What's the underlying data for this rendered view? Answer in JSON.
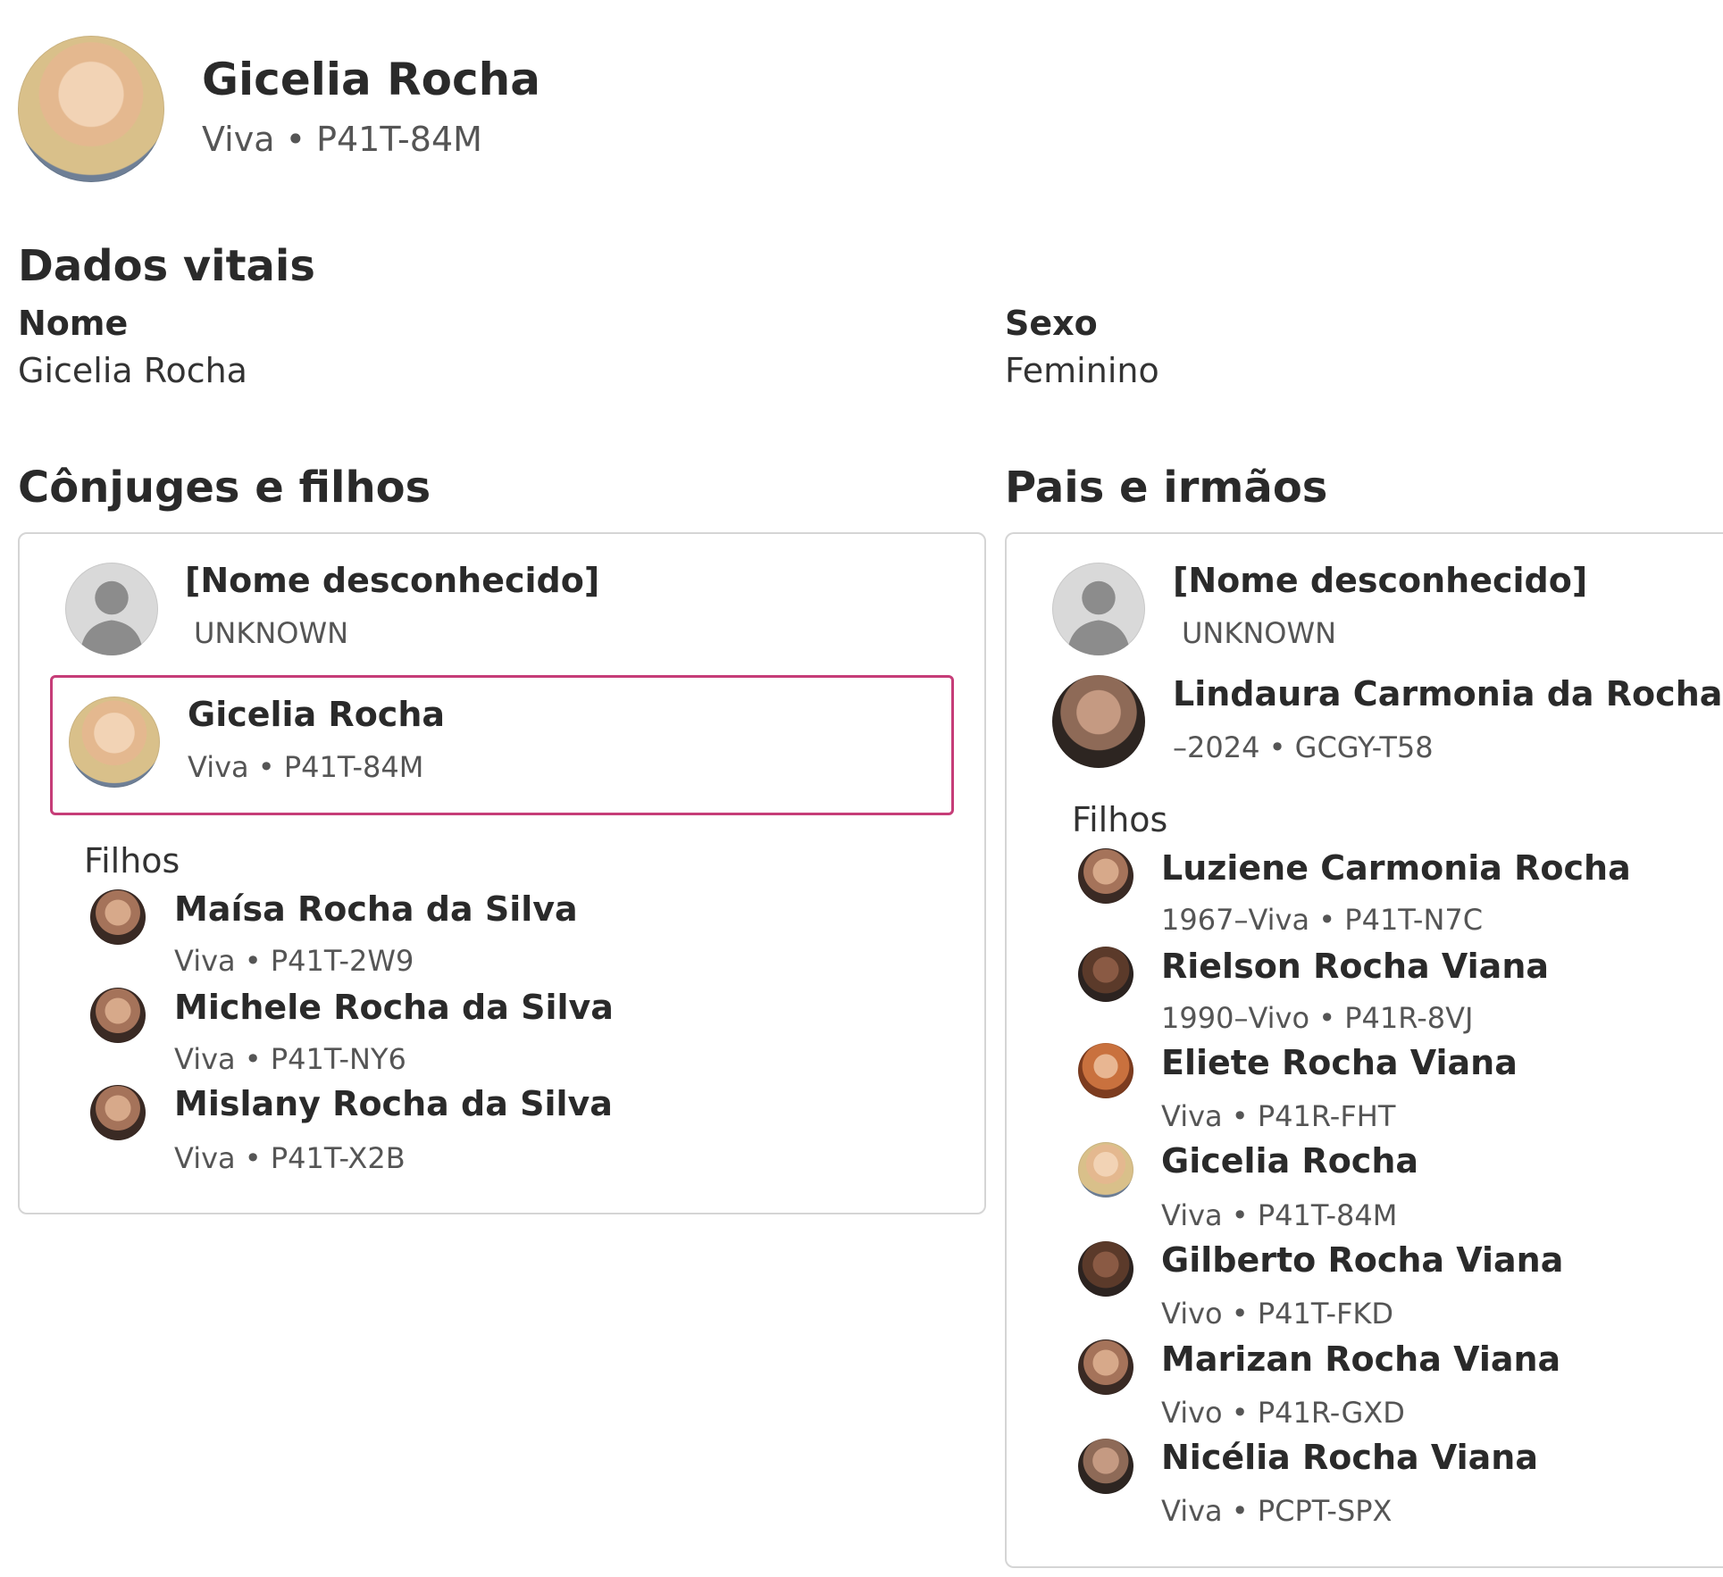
{
  "header": {
    "name": "Gicelia Rocha",
    "sub": "Viva • P41T-84M"
  },
  "vitals": {
    "heading": "Dados vitais",
    "name_label": "Nome",
    "name_value": "Gicelia Rocha",
    "sex_label": "Sexo",
    "sex_value": "Feminino"
  },
  "spouses": {
    "heading": "Cônjuges e filhos",
    "parent1": {
      "name": "[Nome desconhecido]",
      "sub": "UNKNOWN"
    },
    "parent2": {
      "name": "Gicelia Rocha",
      "sub": "Viva • P41T-84M"
    },
    "children_label": "Filhos",
    "children": [
      {
        "name": "Maísa Rocha da Silva",
        "sub": "Viva • P41T-2W9"
      },
      {
        "name": "Michele Rocha da Silva",
        "sub": "Viva • P41T-NY6"
      },
      {
        "name": "Mislany Rocha da Silva",
        "sub": "Viva • P41T-X2B"
      }
    ]
  },
  "parents": {
    "heading": "Pais e irmãos",
    "parent1": {
      "name": "[Nome desconhecido]",
      "sub": "UNKNOWN"
    },
    "parent2": {
      "name": "Lindaura Carmonia da Rocha",
      "sub": "–2024 • GCGY-T58"
    },
    "children_label": "Filhos",
    "children": [
      {
        "name": "Luziene Carmonia Rocha",
        "sub": "1967–Viva • P41T-N7C"
      },
      {
        "name": "Rielson Rocha Viana",
        "sub": "1990–Vivo • P41R-8VJ"
      },
      {
        "name": "Eliete Rocha Viana",
        "sub": "Viva • P41R-FHT"
      },
      {
        "name": "Gicelia Rocha",
        "sub": "Viva • P41T-84M"
      },
      {
        "name": "Gilberto Rocha Viana",
        "sub": "Vivo • P41T-FKD"
      },
      {
        "name": "Marizan Rocha Viana",
        "sub": "Vivo • P41R-GXD"
      },
      {
        "name": "Nicélia Rocha Viana",
        "sub": "Viva • PCPT-SPX"
      }
    ]
  },
  "colors": {
    "selected_border": "#c63d78",
    "card_border": "#d5d5d5",
    "text": "#2a2a2a",
    "muted": "#555555"
  }
}
